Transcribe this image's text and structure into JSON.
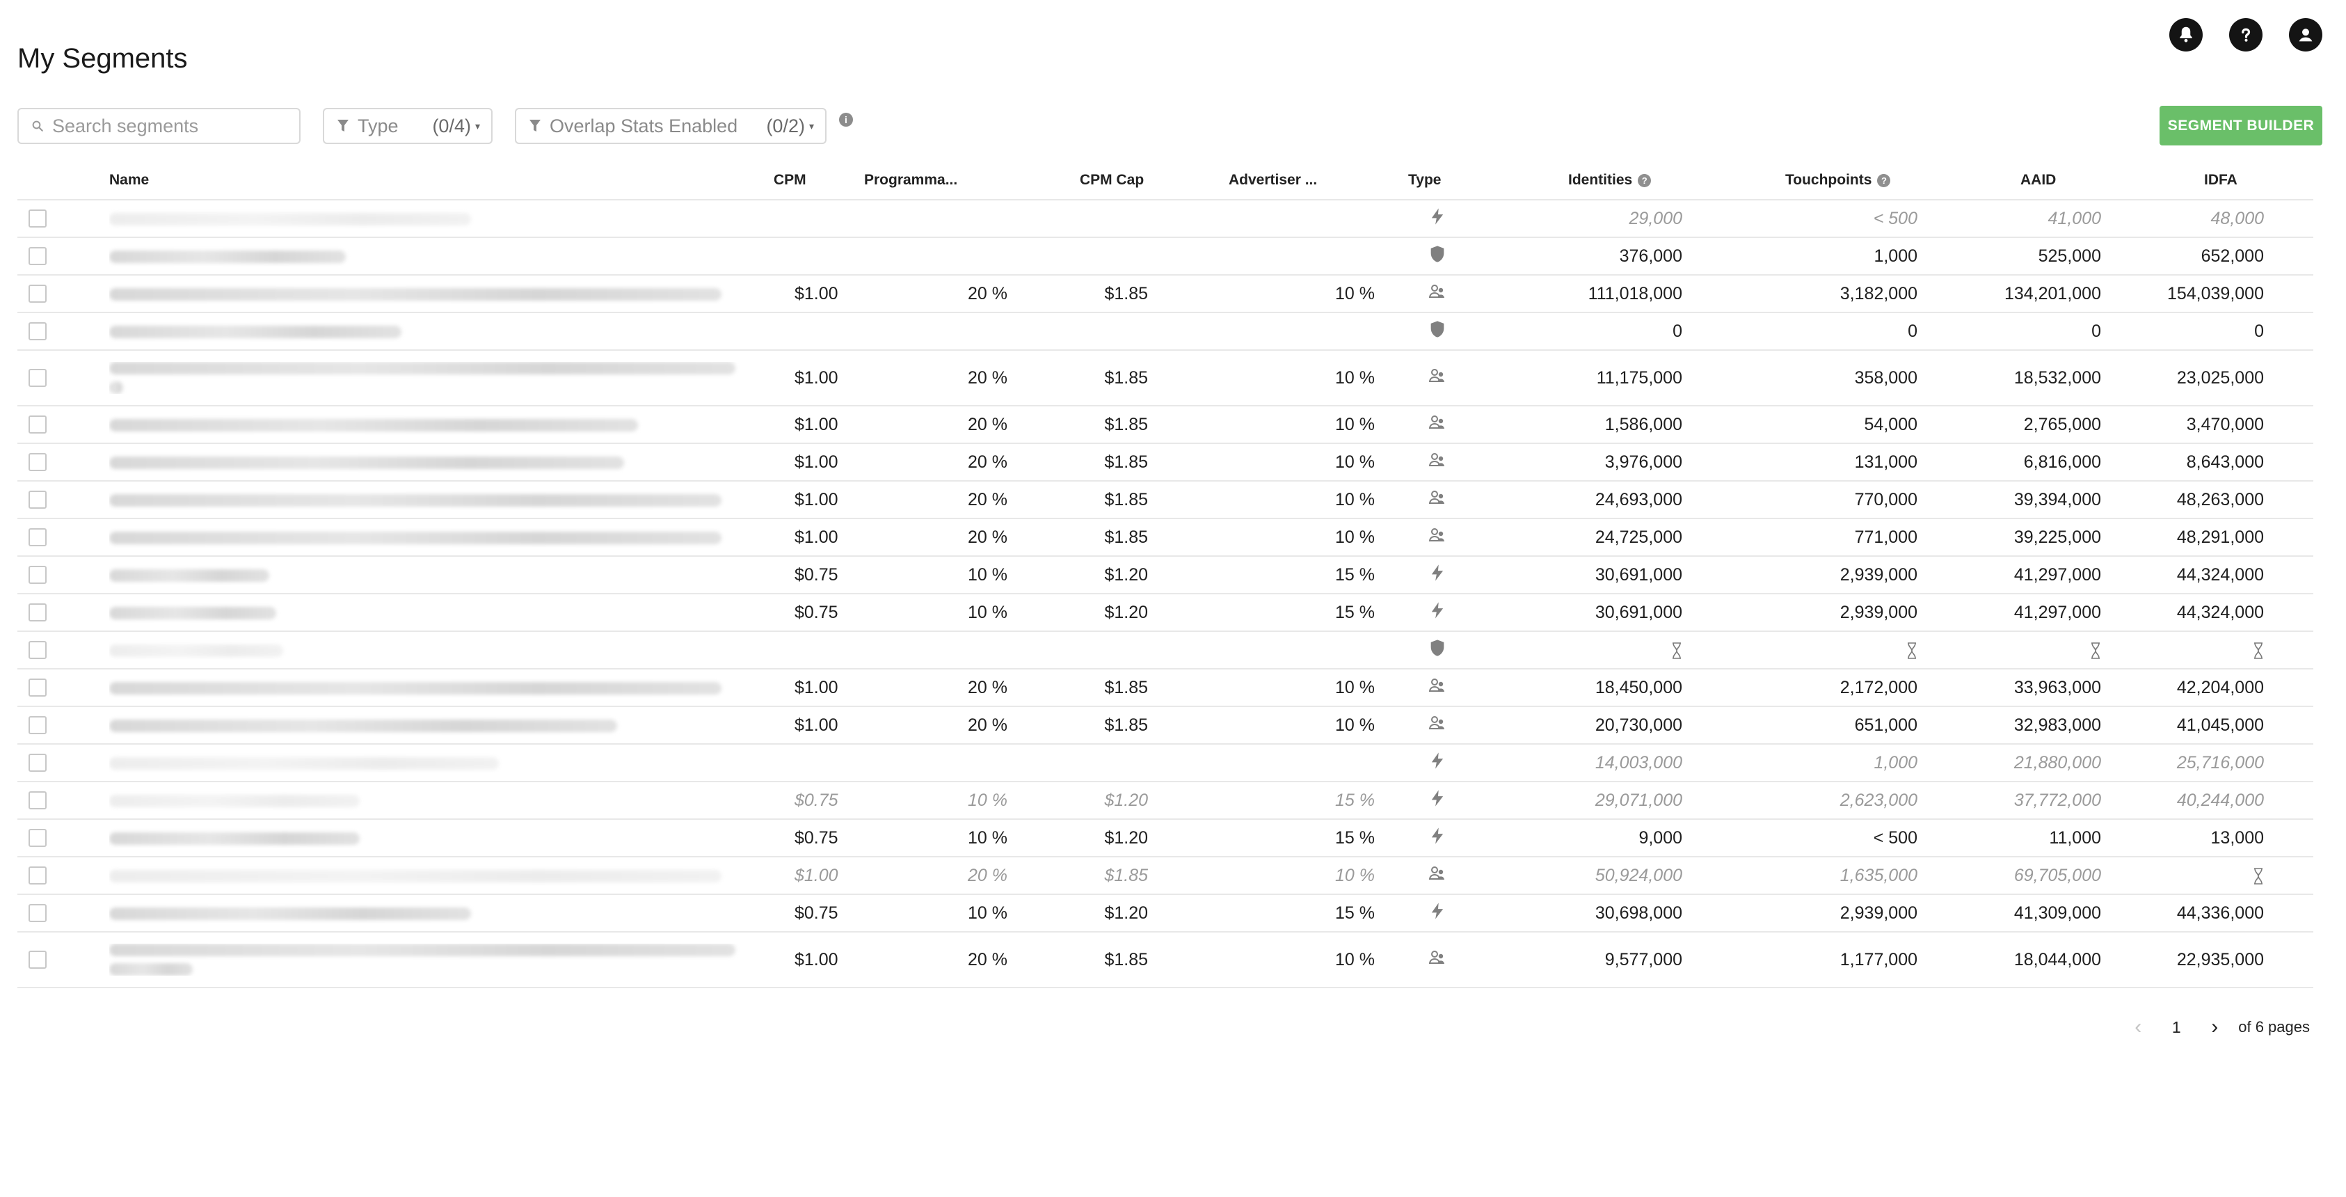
{
  "header": {
    "title": "My Segments",
    "icons": [
      "bell-icon",
      "help-icon",
      "account-icon"
    ]
  },
  "filters": {
    "search_placeholder": "Search segments",
    "type_label": "Type",
    "type_count": "(0/4)",
    "overlap_label": "Overlap Stats Enabled",
    "overlap_count": "(0/2)"
  },
  "builder_button": "SEGMENT BUILDER",
  "columns": {
    "name": "Name",
    "cpm": "CPM",
    "programmatic": "Programma...",
    "cpm_cap": "CPM Cap",
    "advertiser": "Advertiser ...",
    "type": "Type",
    "identities": "Identities",
    "touchpoints": "Touchpoints",
    "aaid": "AAID",
    "idfa": "IDFA"
  },
  "rows": [
    {
      "muted": true,
      "cpm": "",
      "prog": "",
      "cap": "",
      "adv": "",
      "type": "bolt",
      "identities": "29,000",
      "touchpoints": "< 500",
      "aaid": "41,000",
      "idfa": "48,000"
    },
    {
      "muted": false,
      "cpm": "",
      "prog": "",
      "cap": "",
      "adv": "",
      "type": "shield",
      "identities": "376,000",
      "touchpoints": "1,000",
      "aaid": "525,000",
      "idfa": "652,000"
    },
    {
      "muted": false,
      "cpm": "$1.00",
      "prog": "20 %",
      "cap": "$1.85",
      "adv": "10 %",
      "type": "people",
      "identities": "111,018,000",
      "touchpoints": "3,182,000",
      "aaid": "134,201,000",
      "idfa": "154,039,000"
    },
    {
      "muted": false,
      "cpm": "",
      "prog": "",
      "cap": "",
      "adv": "",
      "type": "shield",
      "identities": "0",
      "touchpoints": "0",
      "aaid": "0",
      "idfa": "0"
    },
    {
      "muted": false,
      "tall": true,
      "cpm": "$1.00",
      "prog": "20 %",
      "cap": "$1.85",
      "adv": "10 %",
      "type": "people",
      "identities": "11,175,000",
      "touchpoints": "358,000",
      "aaid": "18,532,000",
      "idfa": "23,025,000"
    },
    {
      "muted": false,
      "cpm": "$1.00",
      "prog": "20 %",
      "cap": "$1.85",
      "adv": "10 %",
      "type": "people",
      "identities": "1,586,000",
      "touchpoints": "54,000",
      "aaid": "2,765,000",
      "idfa": "3,470,000"
    },
    {
      "muted": false,
      "cpm": "$1.00",
      "prog": "20 %",
      "cap": "$1.85",
      "adv": "10 %",
      "type": "people",
      "identities": "3,976,000",
      "touchpoints": "131,000",
      "aaid": "6,816,000",
      "idfa": "8,643,000"
    },
    {
      "muted": false,
      "cpm": "$1.00",
      "prog": "20 %",
      "cap": "$1.85",
      "adv": "10 %",
      "type": "people",
      "identities": "24,693,000",
      "touchpoints": "770,000",
      "aaid": "39,394,000",
      "idfa": "48,263,000"
    },
    {
      "muted": false,
      "cpm": "$1.00",
      "prog": "20 %",
      "cap": "$1.85",
      "adv": "10 %",
      "type": "people",
      "identities": "24,725,000",
      "touchpoints": "771,000",
      "aaid": "39,225,000",
      "idfa": "48,291,000"
    },
    {
      "muted": false,
      "cpm": "$0.75",
      "prog": "10 %",
      "cap": "$1.20",
      "adv": "15 %",
      "type": "bolt",
      "identities": "30,691,000",
      "touchpoints": "2,939,000",
      "aaid": "41,297,000",
      "idfa": "44,324,000"
    },
    {
      "muted": false,
      "cpm": "$0.75",
      "prog": "10 %",
      "cap": "$1.20",
      "adv": "15 %",
      "type": "bolt",
      "identities": "30,691,000",
      "touchpoints": "2,939,000",
      "aaid": "41,297,000",
      "idfa": "44,324,000"
    },
    {
      "muted": true,
      "cpm": "",
      "prog": "",
      "cap": "",
      "adv": "",
      "type": "shield",
      "identities": "hourglass",
      "touchpoints": "hourglass",
      "aaid": "hourglass",
      "idfa": "hourglass"
    },
    {
      "muted": false,
      "cpm": "$1.00",
      "prog": "20 %",
      "cap": "$1.85",
      "adv": "10 %",
      "type": "people",
      "identities": "18,450,000",
      "touchpoints": "2,172,000",
      "aaid": "33,963,000",
      "idfa": "42,204,000"
    },
    {
      "muted": false,
      "cpm": "$1.00",
      "prog": "20 %",
      "cap": "$1.85",
      "adv": "10 %",
      "type": "people",
      "identities": "20,730,000",
      "touchpoints": "651,000",
      "aaid": "32,983,000",
      "idfa": "41,045,000"
    },
    {
      "muted": true,
      "cpm": "",
      "prog": "",
      "cap": "",
      "adv": "",
      "type": "bolt",
      "identities": "14,003,000",
      "touchpoints": "1,000",
      "aaid": "21,880,000",
      "idfa": "25,716,000"
    },
    {
      "muted": true,
      "cpm": "$0.75",
      "prog": "10 %",
      "cap": "$1.20",
      "adv": "15 %",
      "type": "bolt",
      "identities": "29,071,000",
      "touchpoints": "2,623,000",
      "aaid": "37,772,000",
      "idfa": "40,244,000"
    },
    {
      "muted": false,
      "cpm": "$0.75",
      "prog": "10 %",
      "cap": "$1.20",
      "adv": "15 %",
      "type": "bolt",
      "identities": "9,000",
      "touchpoints": "< 500",
      "aaid": "11,000",
      "idfa": "13,000"
    },
    {
      "muted": true,
      "cpm": "$1.00",
      "prog": "20 %",
      "cap": "$1.85",
      "adv": "10 %",
      "type": "people",
      "identities": "50,924,000",
      "touchpoints": "1,635,000",
      "aaid": "69,705,000",
      "idfa": "hourglass"
    },
    {
      "muted": false,
      "cpm": "$0.75",
      "prog": "10 %",
      "cap": "$1.20",
      "adv": "15 %",
      "type": "bolt",
      "identities": "30,698,000",
      "touchpoints": "2,939,000",
      "aaid": "41,309,000",
      "idfa": "44,336,000"
    },
    {
      "muted": false,
      "tall": true,
      "cpm": "$1.00",
      "prog": "20 %",
      "cap": "$1.85",
      "adv": "10 %",
      "type": "people",
      "identities": "9,577,000",
      "touchpoints": "1,177,000",
      "aaid": "18,044,000",
      "idfa": "22,935,000"
    }
  ],
  "pagination": {
    "current": "1",
    "suffix": "of 6 pages"
  }
}
